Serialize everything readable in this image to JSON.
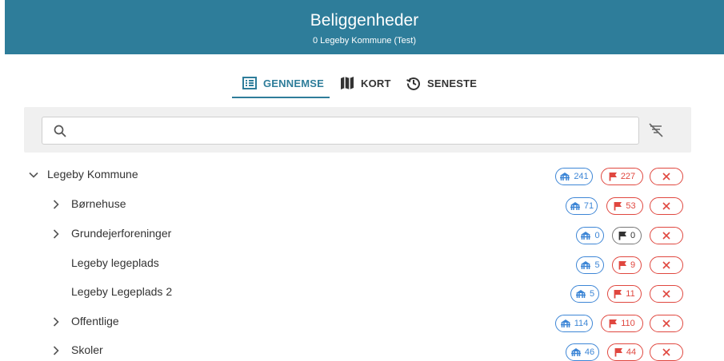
{
  "header": {
    "title": "Beliggenheder",
    "subtitle": "0 Legeby Kommune (Test)",
    "bg_color": "#2e7d9a"
  },
  "tabs": [
    {
      "label": "GENNEMSE",
      "icon": "list-icon",
      "active": true
    },
    {
      "label": "KORT",
      "icon": "map-icon",
      "active": false
    },
    {
      "label": "SENESTE",
      "icon": "history-icon",
      "active": false
    }
  ],
  "search": {
    "value": "",
    "placeholder": ""
  },
  "tree": {
    "root": {
      "label": "Legeby Kommune",
      "expanded": true,
      "playground_count": "241",
      "flag_count": "227",
      "flag_color": "red"
    },
    "children": [
      {
        "label": "Børnehuse",
        "expandable": true,
        "playground_count": "71",
        "flag_count": "53",
        "flag_color": "red"
      },
      {
        "label": "Grundejerforeninger",
        "expandable": true,
        "playground_count": "0",
        "flag_count": "0",
        "flag_color": "dark"
      },
      {
        "label": "Legeby legeplads",
        "expandable": false,
        "playground_count": "5",
        "flag_count": "9",
        "flag_color": "red"
      },
      {
        "label": "Legeby Legeplads 2",
        "expandable": false,
        "playground_count": "5",
        "flag_count": "11",
        "flag_color": "red"
      },
      {
        "label": "Offentlige",
        "expandable": true,
        "playground_count": "114",
        "flag_count": "110",
        "flag_color": "red"
      },
      {
        "label": "Skoler",
        "expandable": true,
        "playground_count": "46",
        "flag_count": "44",
        "flag_color": "red"
      }
    ]
  },
  "colors": {
    "accent": "#2e7d9a",
    "blue": "#3d86d6",
    "red": "#e0473f"
  }
}
